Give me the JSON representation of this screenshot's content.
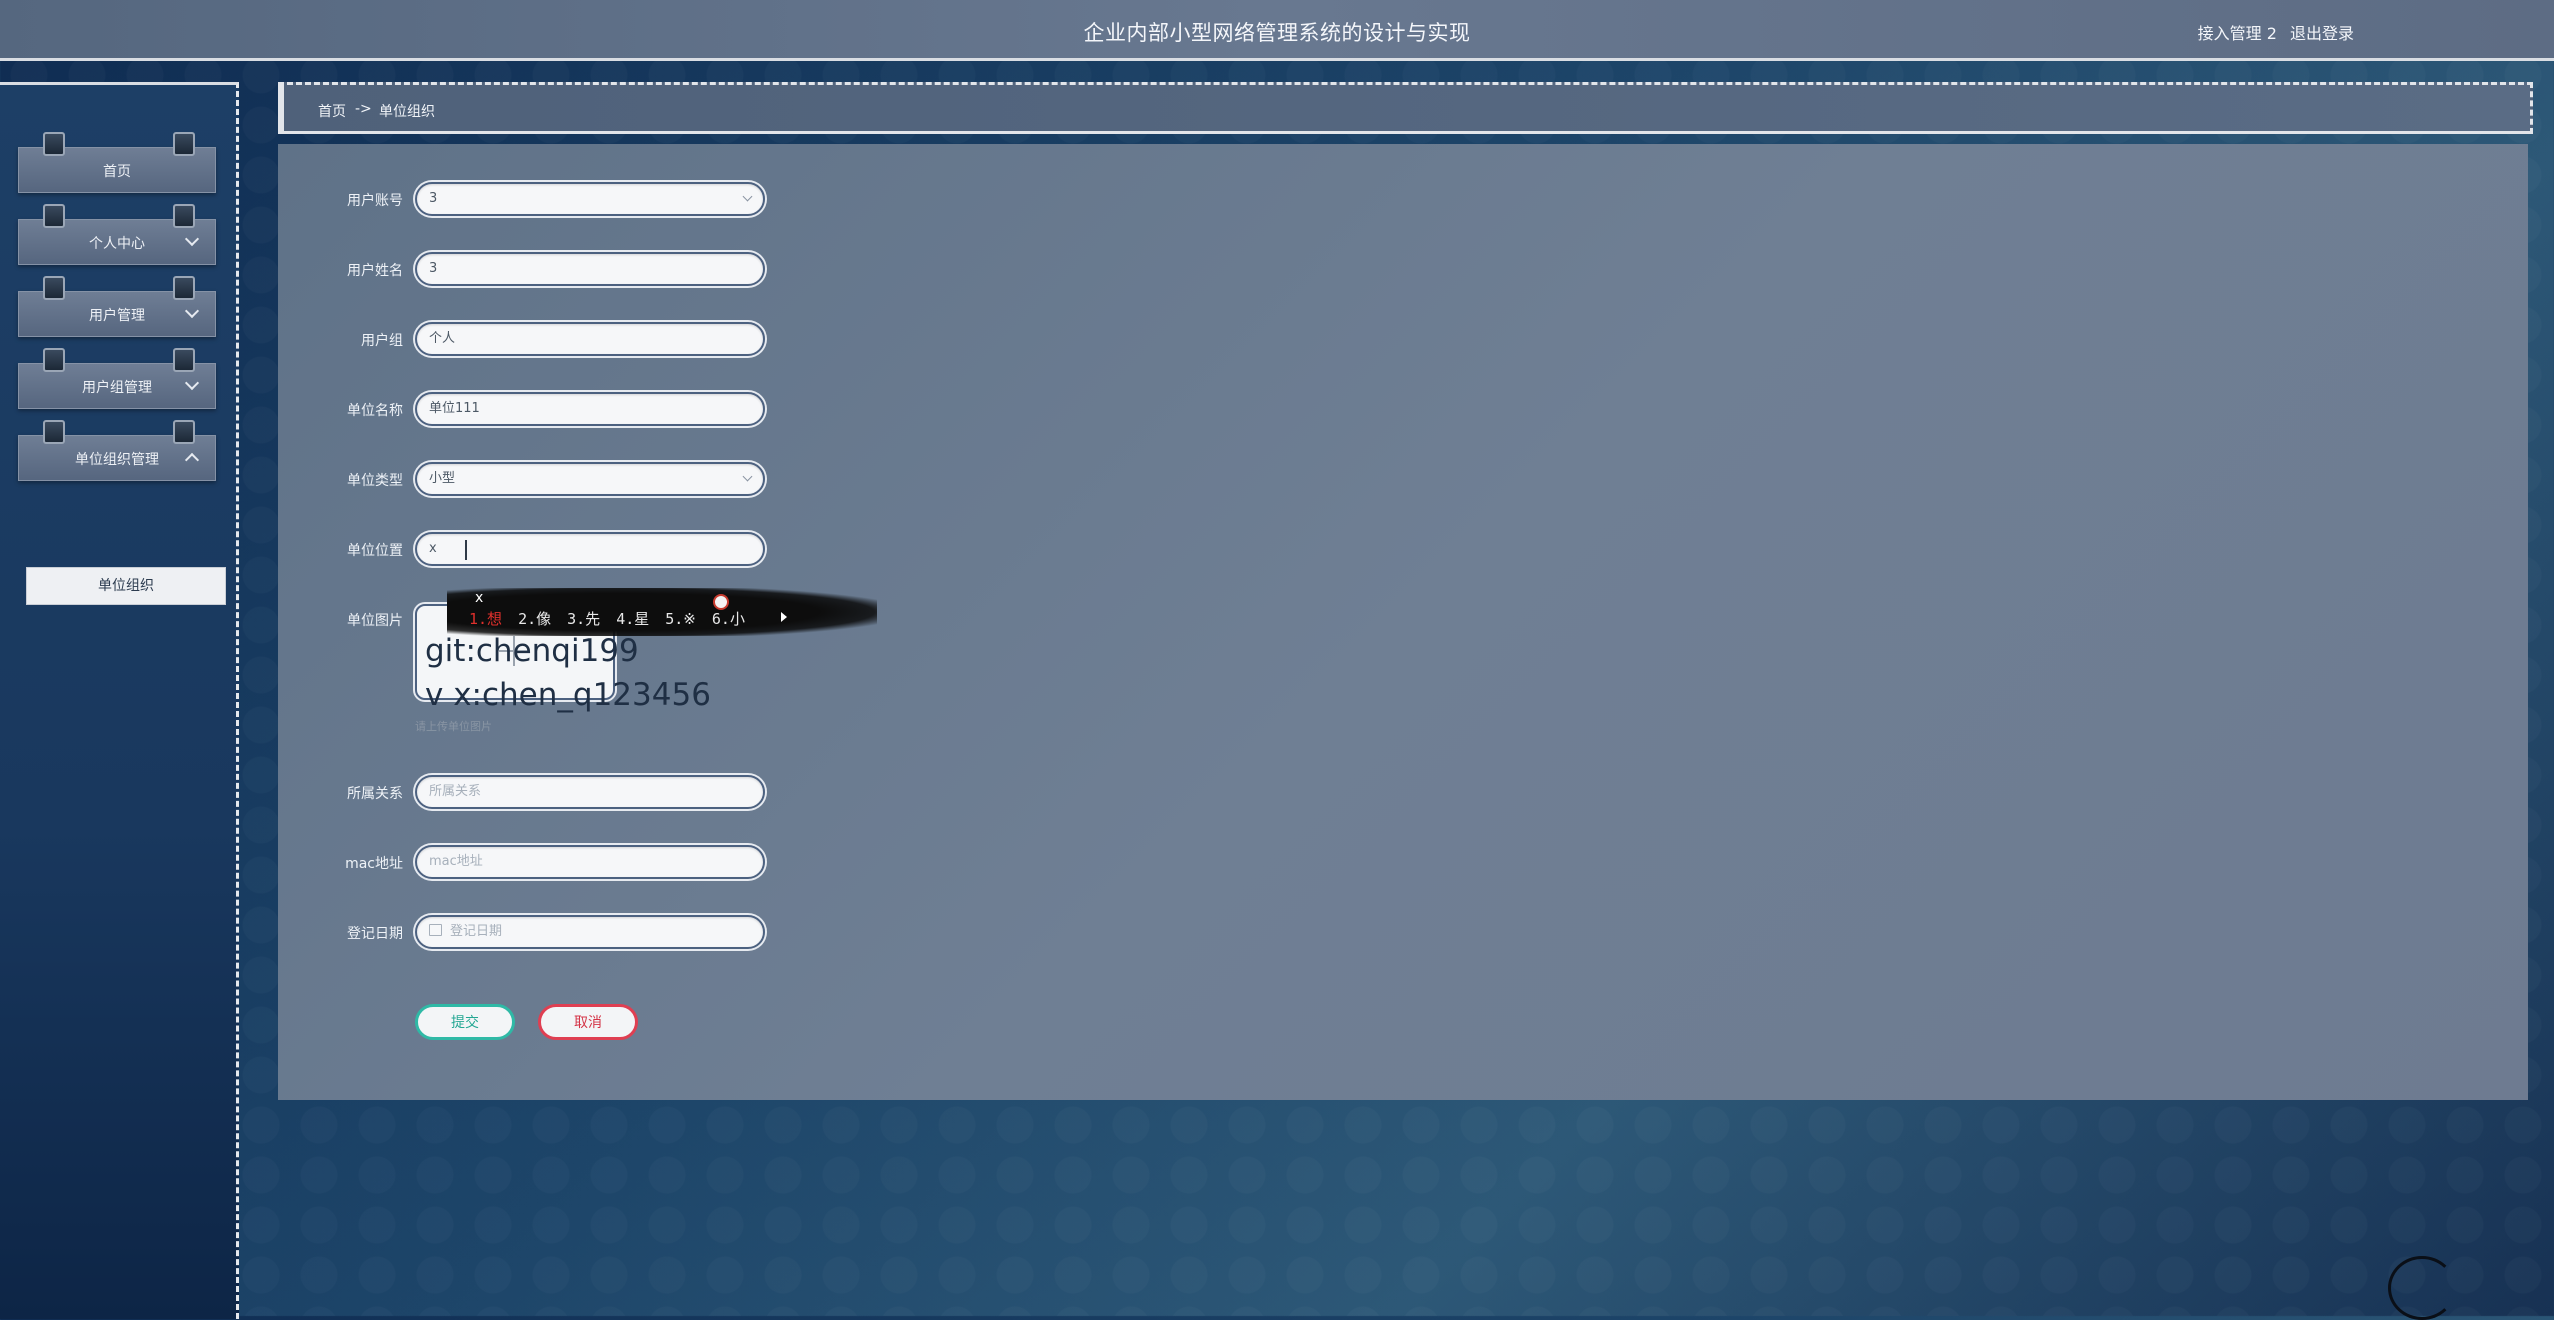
{
  "header": {
    "title": "企业内部小型网络管理系统的设计与实现",
    "user": "接入管理 2",
    "logout": "退出登录"
  },
  "sidebar": {
    "items": [
      {
        "label": "首页"
      },
      {
        "label": "个人中心"
      },
      {
        "label": "用户管理"
      },
      {
        "label": "用户组管理"
      },
      {
        "label": "单位组织管理"
      }
    ],
    "submenu": {
      "label": "单位组织"
    }
  },
  "breadcrumb": {
    "home": "首页",
    "separator": "->",
    "current": "单位组织"
  },
  "form": {
    "account": {
      "label": "用户账号",
      "value": "3"
    },
    "name": {
      "label": "用户姓名",
      "value": "3"
    },
    "group": {
      "label": "用户组",
      "value": "个人"
    },
    "unit_name": {
      "label": "单位名称",
      "value": "单位111"
    },
    "unit_type": {
      "label": "单位类型",
      "value": "小型"
    },
    "unit_location": {
      "label": "单位位置",
      "value": "x"
    },
    "unit_image": {
      "label": "单位图片",
      "hint": "请上传单位图片"
    },
    "relation": {
      "label": "所属关系",
      "placeholder": "所属关系"
    },
    "mac": {
      "label": "mac地址",
      "placeholder": "mac地址"
    },
    "reg_date": {
      "label": "登记日期",
      "placeholder": "登记日期"
    },
    "submit": "提交",
    "cancel": "取消"
  },
  "ime": {
    "close": "x",
    "candidates": [
      "1.想",
      "2.像",
      "3.先",
      "4.星",
      "5.※",
      "6.小"
    ]
  },
  "overlay": {
    "line1": "git:chenqi199",
    "line2": "v x:chen_q123456"
  },
  "colors": {
    "submit": "#2fb9a6",
    "cancel": "#df3f52",
    "ime_selected": "#e0302c"
  }
}
